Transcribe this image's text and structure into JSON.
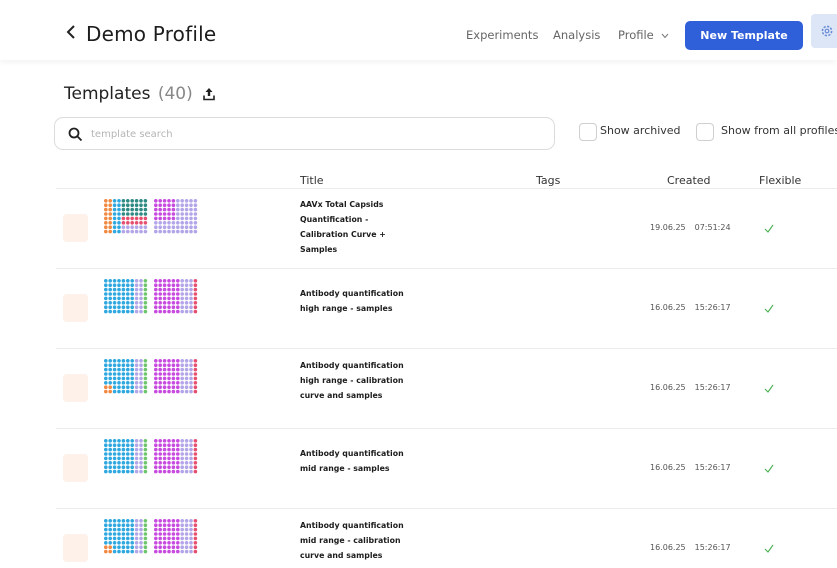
{
  "header": {
    "title": "Demo Profile",
    "nav": {
      "experiments": "Experiments",
      "analysis": "Analysis",
      "profile": "Profile"
    },
    "new_template_label": "New Template"
  },
  "templates": {
    "heading": "Templates",
    "count": "(40)",
    "search_placeholder": "template search",
    "show_archived": "Show archived",
    "show_all_profiles": "Show from all profiles"
  },
  "table": {
    "columns": {
      "title": "Title",
      "tags": "Tags",
      "created": "Created",
      "flexible": "Flexible"
    },
    "rows": [
      {
        "title": "AAVx Total Capsids Quantification - Calibration Curve + Samples",
        "date": "19.06.25",
        "time": "07:51:24",
        "flexible": true,
        "plate": "aavx"
      },
      {
        "title": "Antibody quantification high range - samples",
        "date": "16.06.25",
        "time": "15:26:17",
        "flexible": true,
        "plate": "samples"
      },
      {
        "title": "Antibody quantification high range - calibration curve and samples",
        "date": "16.06.25",
        "time": "15:26:17",
        "flexible": true,
        "plate": "calib"
      },
      {
        "title": "Antibody quantification mid range - samples",
        "date": "16.06.25",
        "time": "15:26:17",
        "flexible": true,
        "plate": "samples"
      },
      {
        "title": "Antibody quantification mid range - calibration curve and samples",
        "date": "16.06.25",
        "time": "15:26:17",
        "flexible": true,
        "plate": "calib"
      }
    ]
  },
  "colors": {
    "accent": "#2f5fd9",
    "check": "#4caf50",
    "well_orange": "#f08a42",
    "well_blue": "#2fa8df",
    "well_lavender": "#b3a6e8",
    "well_teal": "#2f8a84",
    "well_pink": "#e64f70",
    "well_magenta": "#c84be0",
    "well_green": "#6cc76c"
  }
}
